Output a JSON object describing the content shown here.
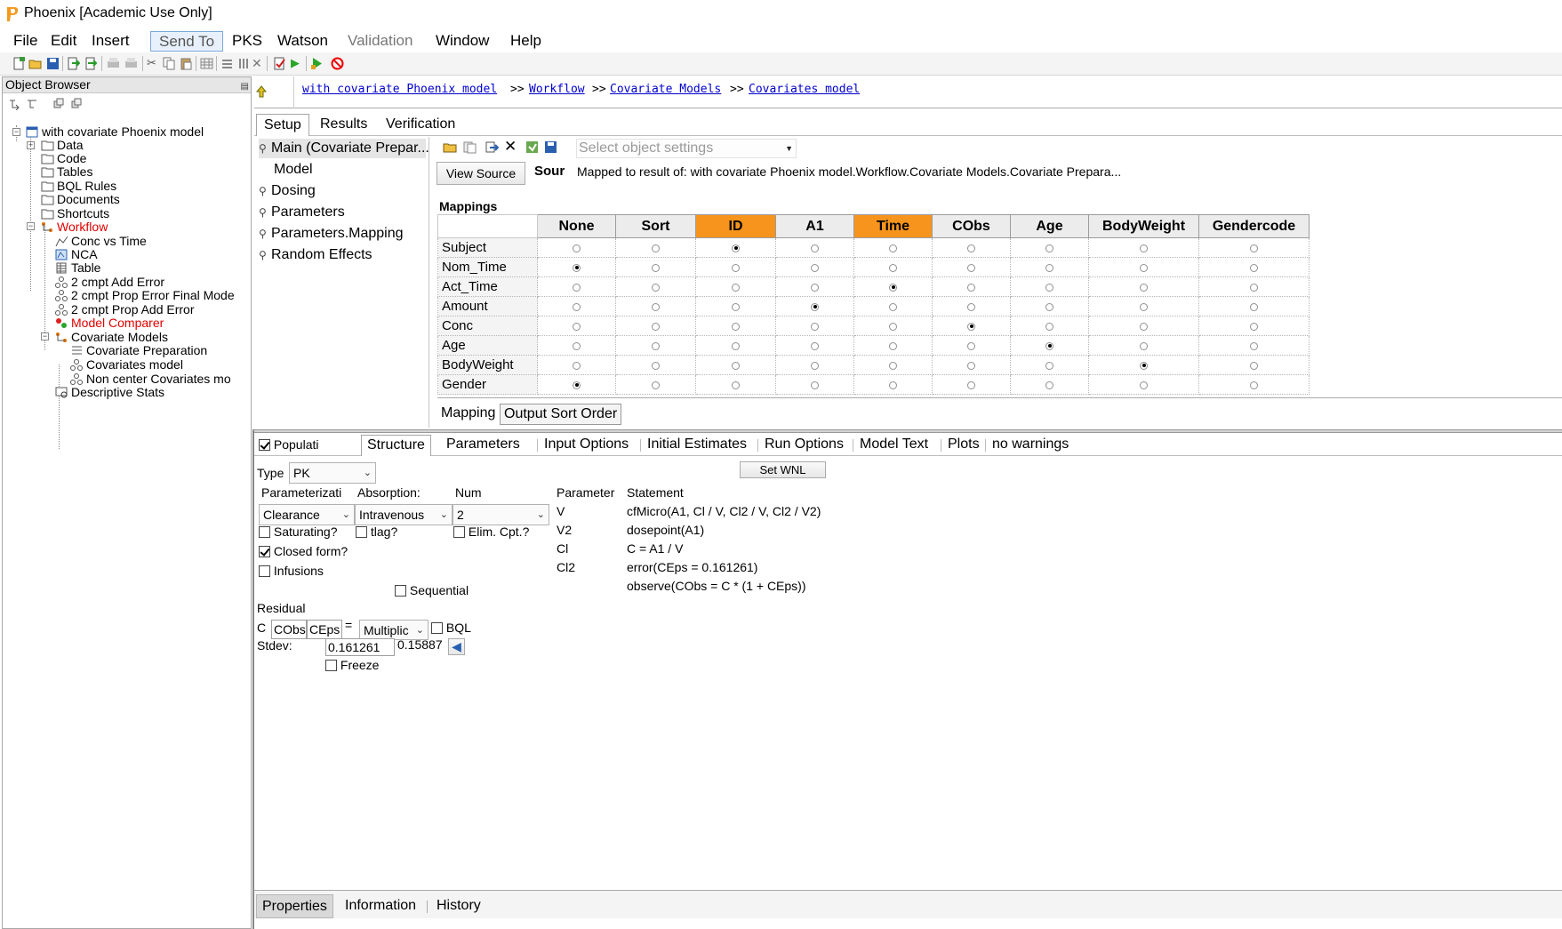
{
  "window": {
    "title": "Phoenix [Academic Use Only]"
  },
  "menu": [
    {
      "label": "File",
      "state": "normal"
    },
    {
      "label": "Edit",
      "state": "normal"
    },
    {
      "label": "Insert",
      "state": "normal"
    },
    {
      "label": "Send To",
      "state": "active"
    },
    {
      "label": "PKS",
      "state": "normal"
    },
    {
      "label": "Watson",
      "state": "normal"
    },
    {
      "label": "Validation",
      "state": "disabled"
    },
    {
      "label": "Window",
      "state": "normal"
    },
    {
      "label": "Help",
      "state": "normal"
    }
  ],
  "object_browser": {
    "title": "Object Browser",
    "tree": [
      {
        "label": "with covariate Phoenix model",
        "icon": "project-icon",
        "color": "normal"
      },
      {
        "label": "Data",
        "icon": "folder-icon",
        "color": "normal"
      },
      {
        "label": "Code",
        "icon": "folder-icon",
        "color": "normal"
      },
      {
        "label": "Tables",
        "icon": "folder-icon",
        "color": "normal"
      },
      {
        "label": "BQL Rules",
        "icon": "folder-icon",
        "color": "normal"
      },
      {
        "label": "Documents",
        "icon": "folder-icon",
        "color": "normal"
      },
      {
        "label": "Shortcuts",
        "icon": "folder-icon",
        "color": "normal"
      },
      {
        "label": "Workflow",
        "icon": "workflow-icon",
        "color": "red"
      },
      {
        "label": "Conc vs Time",
        "icon": "plot-icon",
        "color": "normal"
      },
      {
        "label": "NCA",
        "icon": "nca-icon",
        "color": "normal"
      },
      {
        "label": "Table",
        "icon": "table-icon",
        "color": "normal"
      },
      {
        "label": "2 cmpt Add Error",
        "icon": "model-icon",
        "color": "normal"
      },
      {
        "label": "2 cmpt Prop Error Final Mode",
        "icon": "model-icon",
        "color": "normal"
      },
      {
        "label": "2 cmpt Prop  Add Error",
        "icon": "model-icon",
        "color": "normal"
      },
      {
        "label": "Model Comparer",
        "icon": "comparer-icon",
        "color": "red"
      },
      {
        "label": "Covariate Models",
        "icon": "workflow-icon",
        "color": "normal"
      },
      {
        "label": "Covariate Preparation",
        "icon": "list-icon",
        "color": "normal"
      },
      {
        "label": "Covariates model",
        "icon": "model-icon",
        "color": "normal"
      },
      {
        "label": "Non  center Covariates mo",
        "icon": "model-icon",
        "color": "normal"
      },
      {
        "label": "Descriptive Stats",
        "icon": "stats-icon",
        "color": "normal"
      }
    ]
  },
  "breadcrumb": {
    "items": [
      "with covariate Phoenix model",
      "Workflow",
      "Covariate Models",
      "Covariates model"
    ],
    "separator": ">>"
  },
  "top_tabs": [
    "Setup",
    "Results",
    "Verification"
  ],
  "setup_items": [
    {
      "label": "Main (Covariate Prepar...",
      "icon": true
    },
    {
      "label": "Model",
      "icon": false
    },
    {
      "label": "Dosing",
      "icon": true
    },
    {
      "label": "Parameters",
      "icon": true
    },
    {
      "label": "Parameters.Mapping",
      "icon": true
    },
    {
      "label": "Random Effects",
      "icon": true
    }
  ],
  "object_settings": {
    "placeholder": "Select object settings"
  },
  "source": {
    "button": "View Source",
    "label": "Sour",
    "text": "Mapped to result of: with covariate Phoenix model.Workflow.Covariate Models.Covariate Prepara..."
  },
  "mappings": {
    "label": "Mappings",
    "columns": [
      "None",
      "Sort",
      "ID",
      "A1",
      "Time",
      "CObs",
      "Age",
      "BodyWeight",
      "Gendercode"
    ],
    "highlighted": [
      "ID",
      "Time"
    ],
    "rows": [
      {
        "name": "Subject",
        "selected": "ID"
      },
      {
        "name": "Nom_Time",
        "selected": "None"
      },
      {
        "name": "Act_Time",
        "selected": "Time"
      },
      {
        "name": "Amount",
        "selected": "A1"
      },
      {
        "name": "Conc",
        "selected": "CObs"
      },
      {
        "name": "Age",
        "selected": "Age"
      },
      {
        "name": "BodyWeight",
        "selected": "BodyWeight"
      },
      {
        "name": "Gender",
        "selected": "None"
      }
    ]
  },
  "mapping_tabs": [
    "Mapping",
    "Output Sort Order"
  ],
  "model_tabs": {
    "population_label": "Populati",
    "tabs": [
      "Structure",
      "Parameters",
      "Input Options",
      "Initial Estimates",
      "Run Options",
      "Model Text",
      "Plots",
      "no warnings"
    ]
  },
  "structure": {
    "type_label": "Type",
    "type_value": "PK",
    "set_wnl": "Set WNL",
    "parameterization_label": "Parameterizati",
    "parameterization_value": "Clearance",
    "absorption_label": "Absorption:",
    "absorption_value": "Intravenous",
    "num_label": "Num",
    "num_value": "2",
    "saturating": "Saturating?",
    "tlag": "tlag?",
    "elim": "Elim. Cpt.?",
    "closed_form": "Closed form?",
    "infusions": "Infusions",
    "sequential": "Sequential",
    "residual_label": "Residual",
    "c_label": "C",
    "cobs_value": "CObs",
    "ceps_value": "CEps",
    "equals": "=",
    "error_model": "Multiplic",
    "bql": "BQL",
    "stdev_label": "Stdev:",
    "stdev_value": "0.161261",
    "stdev_prev": "0.15887",
    "freeze": "Freeze"
  },
  "statements": {
    "param_header": "Parameter",
    "stmt_header": "Statement",
    "rows": [
      {
        "param": "V",
        "stmt": "cfMicro(A1, Cl / V, Cl2 / V, Cl2 / V2)"
      },
      {
        "param": "V2",
        "stmt": "dosepoint(A1)"
      },
      {
        "param": "Cl",
        "stmt": "C = A1 / V"
      },
      {
        "param": "Cl2",
        "stmt": "error(CEps = 0.161261)"
      },
      {
        "param": "",
        "stmt": "observe(CObs = C * (1 + CEps))"
      }
    ]
  },
  "bottom_tabs": [
    "Properties",
    "Information",
    "History"
  ]
}
